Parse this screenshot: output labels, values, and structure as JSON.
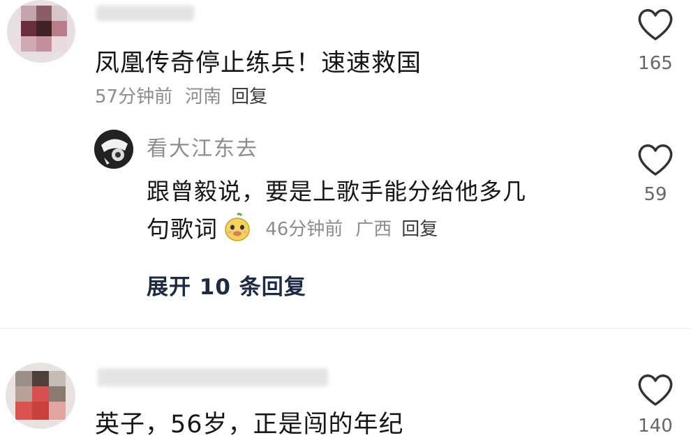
{
  "comments": [
    {
      "text": "凤凰传奇停止练兵！速速救国",
      "time": "57分钟前",
      "location": "河南",
      "reply_label": "回复",
      "likes": "165"
    },
    {
      "text": "英子，56岁，正是闯的年纪",
      "likes": "140"
    }
  ],
  "reply": {
    "username": "看大江东去",
    "text_line1": "跟曾毅说，要是上歌手能分给他多几",
    "text_line2": "句歌词",
    "time": "46分钟前",
    "location": "广西",
    "reply_label": "回复",
    "likes": "59"
  },
  "expand_label": "展开 10 条回复",
  "icons": {
    "like": "heart-outline-icon",
    "emoji": "duck-face-emoji-icon"
  },
  "colors": {
    "text": "#161616",
    "meta": "#8c8c8c",
    "expand": "#1d2a44"
  }
}
